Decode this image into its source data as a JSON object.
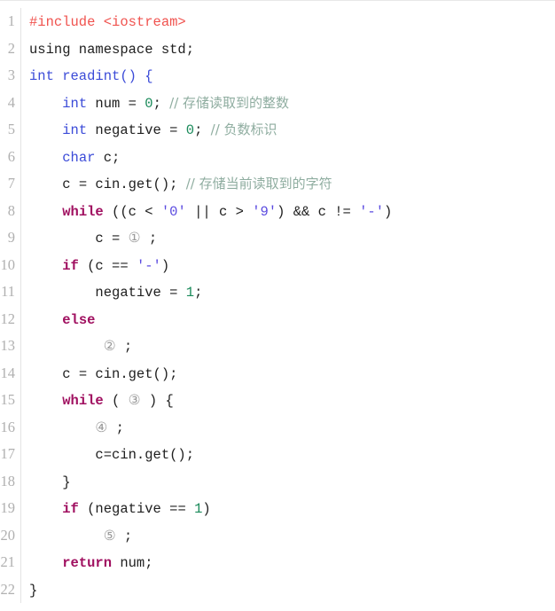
{
  "editor": {
    "language": "C++",
    "total_lines": 22,
    "colors": {
      "background": "#ffffff",
      "gutter_text": "#b0b0b0",
      "gutter_border": "#e4e4e4",
      "preprocessor": "#f0534f",
      "type": "#3b4bd8",
      "keyword": "#a01060",
      "number": "#1a8a5a",
      "char_literal": "#5a4ae0",
      "comment": "#8fada0",
      "plain": "#202020",
      "blank_marker": "#9a9a9a"
    }
  },
  "lines": [
    {
      "number": "1",
      "indent": "",
      "tokens": [
        {
          "t": "#include <iostream>",
          "c": "pre"
        }
      ]
    },
    {
      "number": "2",
      "indent": "",
      "tokens": [
        {
          "t": "using namespace std;",
          "c": "plain"
        }
      ]
    },
    {
      "number": "3",
      "indent": "",
      "tokens": [
        {
          "t": "int readint() {",
          "c": "type"
        }
      ]
    },
    {
      "number": "4",
      "indent": "    ",
      "tokens": [
        {
          "t": "int",
          "c": "type"
        },
        {
          "t": " num = ",
          "c": "plain"
        },
        {
          "t": "0",
          "c": "num"
        },
        {
          "t": "; ",
          "c": "plain"
        },
        {
          "t": "// 存储读取到的整数",
          "c": "cmt"
        }
      ]
    },
    {
      "number": "5",
      "indent": "    ",
      "tokens": [
        {
          "t": "int",
          "c": "type"
        },
        {
          "t": " negative = ",
          "c": "plain"
        },
        {
          "t": "0",
          "c": "num"
        },
        {
          "t": "; ",
          "c": "plain"
        },
        {
          "t": "// 负数标识",
          "c": "cmt"
        }
      ]
    },
    {
      "number": "6",
      "indent": "    ",
      "tokens": [
        {
          "t": "char",
          "c": "type"
        },
        {
          "t": " c;",
          "c": "plain"
        }
      ]
    },
    {
      "number": "7",
      "indent": "    ",
      "tokens": [
        {
          "t": "c = cin.get(); ",
          "c": "plain"
        },
        {
          "t": "// 存储当前读取到的字符",
          "c": "cmt"
        }
      ]
    },
    {
      "number": "8",
      "indent": "    ",
      "tokens": [
        {
          "t": "while",
          "c": "kw"
        },
        {
          "t": " ((c < ",
          "c": "plain"
        },
        {
          "t": "'0'",
          "c": "chr"
        },
        {
          "t": " || c > ",
          "c": "plain"
        },
        {
          "t": "'9'",
          "c": "chr"
        },
        {
          "t": ") && c != ",
          "c": "plain"
        },
        {
          "t": "'-'",
          "c": "chr"
        },
        {
          "t": ")",
          "c": "plain"
        }
      ]
    },
    {
      "number": "9",
      "indent": "        ",
      "tokens": [
        {
          "t": "c = ",
          "c": "plain"
        },
        {
          "t": "①",
          "c": "blank"
        },
        {
          "t": " ;",
          "c": "plain"
        }
      ]
    },
    {
      "number": "10",
      "indent": "    ",
      "tokens": [
        {
          "t": "if",
          "c": "kw"
        },
        {
          "t": " (c == ",
          "c": "plain"
        },
        {
          "t": "'-'",
          "c": "chr"
        },
        {
          "t": ")",
          "c": "plain"
        }
      ]
    },
    {
      "number": "11",
      "indent": "        ",
      "tokens": [
        {
          "t": "negative = ",
          "c": "plain"
        },
        {
          "t": "1",
          "c": "num"
        },
        {
          "t": ";",
          "c": "plain"
        }
      ]
    },
    {
      "number": "12",
      "indent": "    ",
      "tokens": [
        {
          "t": "else",
          "c": "kw"
        }
      ]
    },
    {
      "number": "13",
      "indent": "         ",
      "tokens": [
        {
          "t": "②",
          "c": "blank"
        },
        {
          "t": " ;",
          "c": "plain"
        }
      ]
    },
    {
      "number": "14",
      "indent": "    ",
      "tokens": [
        {
          "t": "c = cin.get();",
          "c": "plain"
        }
      ]
    },
    {
      "number": "15",
      "indent": "    ",
      "tokens": [
        {
          "t": "while",
          "c": "kw"
        },
        {
          "t": " ( ",
          "c": "plain"
        },
        {
          "t": "③",
          "c": "blank"
        },
        {
          "t": " ) {",
          "c": "plain"
        }
      ]
    },
    {
      "number": "16",
      "indent": "        ",
      "tokens": [
        {
          "t": "④",
          "c": "blank"
        },
        {
          "t": " ;",
          "c": "plain"
        }
      ]
    },
    {
      "number": "17",
      "indent": "        ",
      "tokens": [
        {
          "t": "c=cin.get();",
          "c": "plain"
        }
      ]
    },
    {
      "number": "18",
      "indent": "    ",
      "tokens": [
        {
          "t": "}",
          "c": "plain"
        }
      ]
    },
    {
      "number": "19",
      "indent": "    ",
      "tokens": [
        {
          "t": "if",
          "c": "kw"
        },
        {
          "t": " (negative == ",
          "c": "plain"
        },
        {
          "t": "1",
          "c": "num"
        },
        {
          "t": ")",
          "c": "plain"
        }
      ]
    },
    {
      "number": "20",
      "indent": "         ",
      "tokens": [
        {
          "t": "⑤",
          "c": "blank"
        },
        {
          "t": " ;",
          "c": "plain"
        }
      ]
    },
    {
      "number": "21",
      "indent": "    ",
      "tokens": [
        {
          "t": "return",
          "c": "kw"
        },
        {
          "t": " num;",
          "c": "plain"
        }
      ]
    },
    {
      "number": "22",
      "indent": "",
      "tokens": [
        {
          "t": "}",
          "c": "plain"
        }
      ]
    }
  ]
}
